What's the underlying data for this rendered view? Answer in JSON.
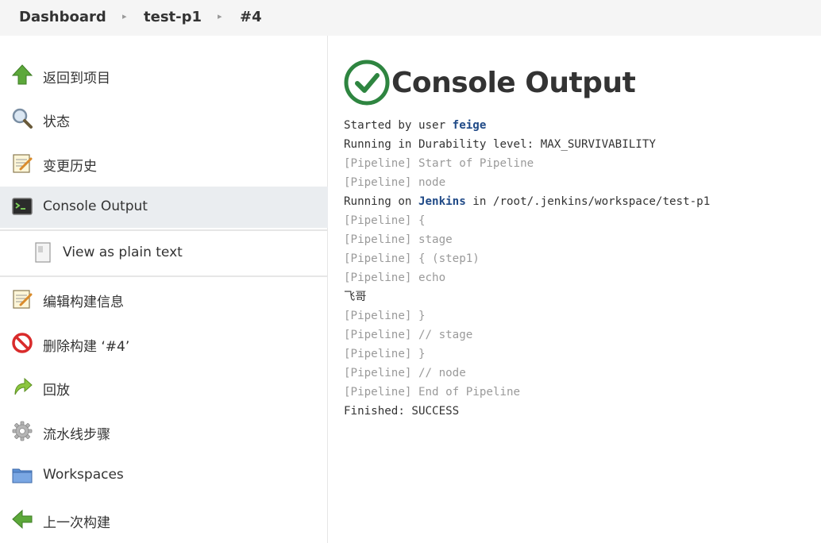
{
  "breadcrumb": {
    "dashboard": "Dashboard",
    "job": "test-p1",
    "build": "#4"
  },
  "sidebar": {
    "items": [
      {
        "label": "返回到项目",
        "icon": "up-arrow-icon"
      },
      {
        "label": "状态",
        "icon": "search-icon"
      },
      {
        "label": "变更历史",
        "icon": "notepad-icon"
      },
      {
        "label": "Console Output",
        "icon": "terminal-icon"
      },
      {
        "label": "View as plain text",
        "icon": "document-icon"
      },
      {
        "label": "编辑构建信息",
        "icon": "notepad-icon"
      },
      {
        "label": "删除构建 ‘#4’",
        "icon": "no-entry-icon"
      },
      {
        "label": "回放",
        "icon": "redo-arrow-icon"
      },
      {
        "label": "流水线步骤",
        "icon": "gear-icon"
      },
      {
        "label": "Workspaces",
        "icon": "folder-icon"
      },
      {
        "label": "上一次构建",
        "icon": "left-arrow-icon"
      }
    ]
  },
  "main": {
    "title": "Console Output",
    "status_icon": "success-check-icon",
    "console": {
      "l1_prefix": "Started by user ",
      "l1_user": "feige",
      "l2": "Running in Durability level: MAX_SURVIVABILITY",
      "l3": "[Pipeline] Start of Pipeline",
      "l4": "[Pipeline] node",
      "l5_prefix": "Running on ",
      "l5_node": "Jenkins",
      "l5_suffix": " in /root/.jenkins/workspace/test-p1",
      "l6": "[Pipeline] {",
      "l7": "[Pipeline] stage",
      "l8": "[Pipeline] { (step1)",
      "l9": "[Pipeline] echo",
      "l10": "飞哥",
      "l11": "[Pipeline] }",
      "l12": "[Pipeline] // stage",
      "l13": "[Pipeline] }",
      "l14": "[Pipeline] // node",
      "l15": "[Pipeline] End of Pipeline",
      "l16": "Finished: SUCCESS"
    }
  },
  "colors": {
    "success_green": "#2e8540",
    "link_blue": "#204a87",
    "pipeline_gray": "#9a9a9a"
  }
}
